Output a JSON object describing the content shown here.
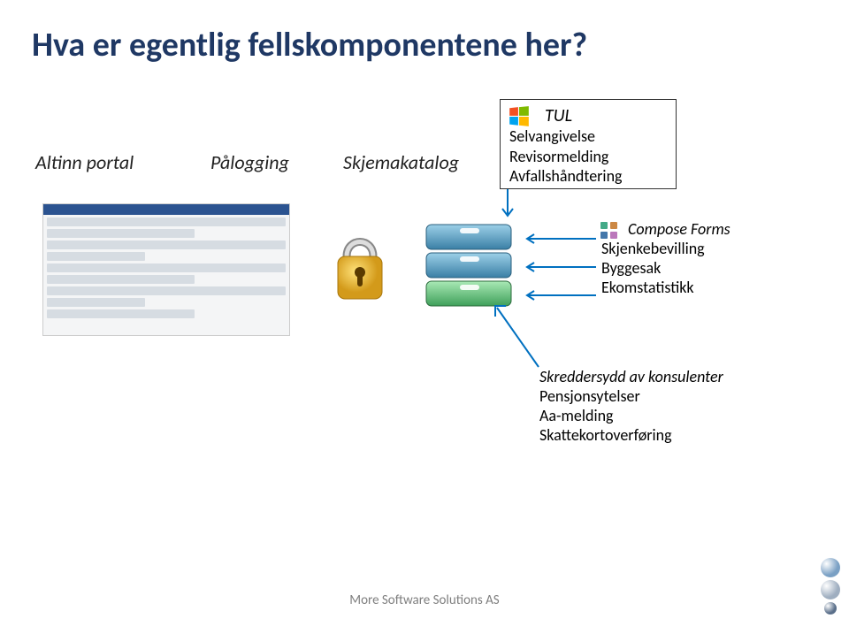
{
  "title": "Hva er egentlig fellskomponentene her?",
  "columns": {
    "altinn": "Altinn portal",
    "palogging": "Pålogging",
    "skjemakatalog": "Skjemakatalog"
  },
  "tul": {
    "heading": "TUL",
    "items": [
      "Selvangivelse",
      "Revisormelding",
      "Avfallshåndtering"
    ]
  },
  "compose": {
    "heading": "Compose Forms",
    "items": [
      "Skjenkebevilling",
      "Byggesak",
      "Ekomstatistikk"
    ]
  },
  "custom": {
    "heading": "Skreddersydd av konsulenter",
    "items": [
      "Pensjonsytelser",
      "Aa-melding",
      "Skattekortoverføring"
    ]
  },
  "footer": "More Software Solutions AS"
}
